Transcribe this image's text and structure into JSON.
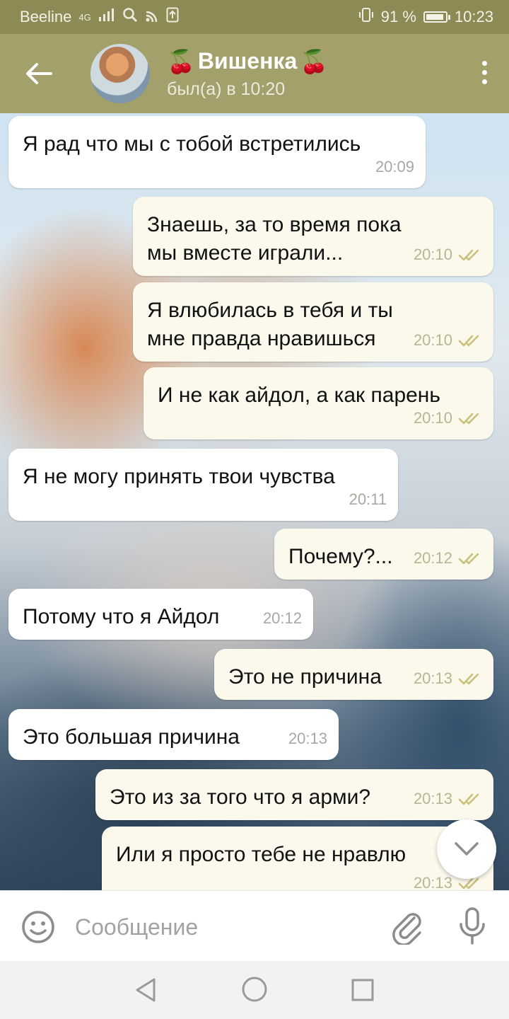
{
  "status_bar": {
    "carrier": "Beeline",
    "network": "4G",
    "battery": "91 %",
    "battery_level": 0.91,
    "time": "10:23",
    "icons": [
      "signal-icon",
      "search-icon",
      "wifi-icon",
      "upload-icon",
      "vibrate-icon",
      "battery-icon"
    ]
  },
  "header": {
    "back_icon": "arrow-left-icon",
    "title": "Вишенка",
    "title_emoji": "🍒",
    "subtitle": "был(а) в 10:20",
    "menu_icon": "more-vertical-icon"
  },
  "messages": [
    {
      "dir": "in",
      "text": "Я рад что мы с тобой встретились",
      "time": "20:09"
    },
    {
      "dir": "out",
      "text": "Знаешь, за то время пока мы вместе играли...",
      "time": "20:10",
      "read": true
    },
    {
      "dir": "out",
      "text": "Я влюбилась в тебя и ты мне правда нравишься",
      "time": "20:10",
      "read": true
    },
    {
      "dir": "out",
      "text": "И не как айдол, а как парень",
      "time": "20:10",
      "read": true
    },
    {
      "dir": "in",
      "text": "Я не могу принять твои чувства",
      "time": "20:11"
    },
    {
      "dir": "out",
      "text": "Почему?...",
      "time": "20:12",
      "read": true
    },
    {
      "dir": "in",
      "text": "Потому что я Айдол",
      "time": "20:12"
    },
    {
      "dir": "out",
      "text": "Это не причина",
      "time": "20:13",
      "read": true
    },
    {
      "dir": "in",
      "text": "Это большая причина",
      "time": "20:13"
    },
    {
      "dir": "out",
      "text": "Это из за того что я арми?",
      "time": "20:13",
      "read": true
    },
    {
      "dir": "out",
      "text": "Или я просто тебе не нравлю",
      "time": "20:13",
      "read": true
    }
  ],
  "scroll_down_icon": "chevron-down-icon",
  "composer": {
    "placeholder": "Сообщение",
    "value": "",
    "emoji_icon": "smiley-icon",
    "attach_icon": "paperclip-icon",
    "mic_icon": "microphone-icon"
  },
  "nav_bar": {
    "icons": [
      "triangle-back-icon",
      "circle-home-icon",
      "square-recents-icon"
    ]
  },
  "colors": {
    "header_bg": "#a3a06b",
    "status_bg": "#8e8a55",
    "outgoing_bubble": "#fbf8ec",
    "incoming_bubble": "#ffffff",
    "read_ticks": "#c9c07a"
  }
}
